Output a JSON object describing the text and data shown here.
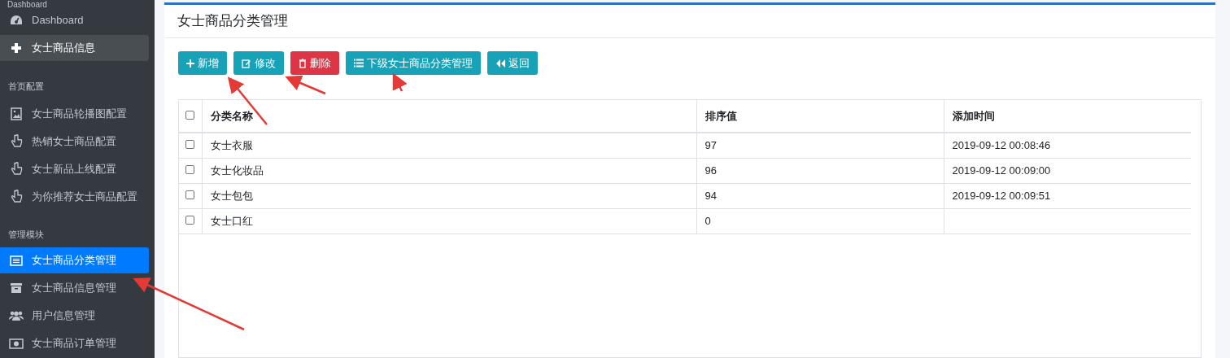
{
  "sidebar": {
    "header": "Dashboard",
    "groups": [
      {
        "items": [
          {
            "label": "Dashboard",
            "selected": false,
            "hovered": false
          },
          {
            "label": "女士商品信息",
            "selected": false,
            "hovered": true
          }
        ]
      },
      {
        "title": "首页配置",
        "items": [
          {
            "label": "女士商品轮播图配置",
            "selected": false,
            "hovered": false
          },
          {
            "label": "热销女士商品配置",
            "selected": false,
            "hovered": false
          },
          {
            "label": "女士新品上线配置",
            "selected": false,
            "hovered": false
          },
          {
            "label": "为你推荐女士商品配置",
            "selected": false,
            "hovered": false
          }
        ]
      },
      {
        "title": "管理模块",
        "items": [
          {
            "label": "女士商品分类管理",
            "selected": true,
            "hovered": false
          },
          {
            "label": "女士商品信息管理",
            "selected": false,
            "hovered": false
          },
          {
            "label": "用户信息管理",
            "selected": false,
            "hovered": false
          },
          {
            "label": "女士商品订单管理",
            "selected": false,
            "hovered": false
          }
        ]
      }
    ]
  },
  "card": {
    "title": "女士商品分类管理",
    "buttons": [
      {
        "label": "新增",
        "kind": "add"
      },
      {
        "label": "修改",
        "kind": "edit"
      },
      {
        "label": "删除",
        "kind": "delete"
      },
      {
        "label": "下级女士商品分类管理",
        "kind": "list"
      },
      {
        "label": "返回",
        "kind": "back"
      }
    ],
    "table": {
      "header_checked": false,
      "columns": [
        "分类名称",
        "排序值",
        "添加时间"
      ],
      "rows": [
        {
          "checked": false,
          "cells": [
            "女士衣服",
            "97",
            "2019-09-12 00:08:46"
          ]
        },
        {
          "checked": false,
          "cells": [
            "女士化妆品",
            "96",
            "2019-09-12 00:09:00"
          ]
        },
        {
          "checked": false,
          "cells": [
            "女士包包",
            "94",
            "2019-09-12 00:09:51"
          ]
        },
        {
          "checked": false,
          "cells": [
            "女士口红",
            "0",
            ""
          ]
        }
      ]
    }
  }
}
